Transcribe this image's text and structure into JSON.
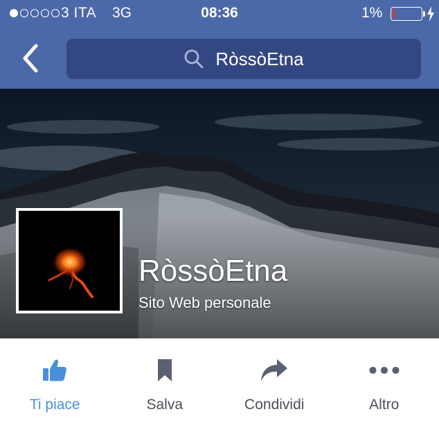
{
  "status_bar": {
    "carrier": "3 ITA",
    "network": "3G",
    "time": "08:36",
    "battery": "1%",
    "signal_dots_filled": 1,
    "signal_dots_total": 5
  },
  "nav": {
    "back_icon": "chevron-left-icon",
    "search_icon": "search-icon",
    "search_text": "RòssòEtna"
  },
  "page": {
    "name": "RòssòEtna",
    "category": "Sito Web personale"
  },
  "actions": [
    {
      "label": "Ti piace",
      "icon": "thumbs-up-icon",
      "active": true
    },
    {
      "label": "Salva",
      "icon": "bookmark-icon",
      "active": false
    },
    {
      "label": "Condividi",
      "icon": "share-arrow-icon",
      "active": false
    },
    {
      "label": "Altro",
      "icon": "more-dots-icon",
      "active": false
    }
  ],
  "colors": {
    "brand_blue": "#4b68a9",
    "search_bg": "#334883",
    "active_blue": "#4a90d9",
    "icon_gray": "#5b6170",
    "battery_low": "#e8332a"
  }
}
